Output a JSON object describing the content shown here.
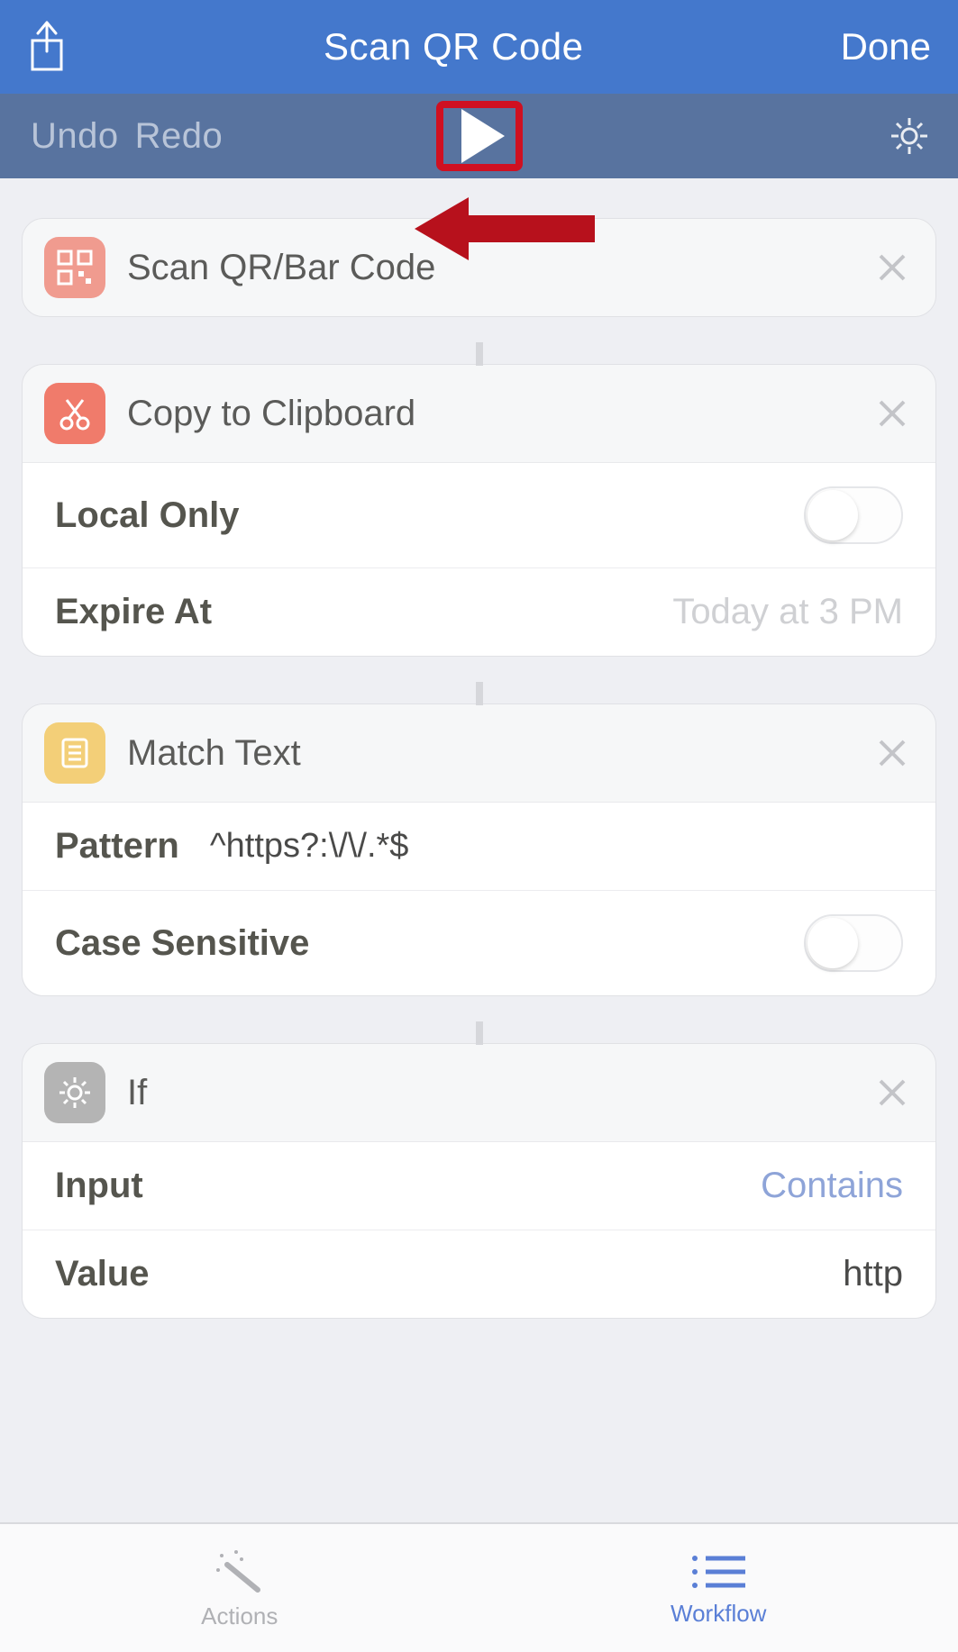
{
  "navbar": {
    "title": "Scan QR Code",
    "done": "Done"
  },
  "toolbar": {
    "undo": "Undo",
    "redo": "Redo"
  },
  "cards": {
    "scan": {
      "title": "Scan QR/Bar Code"
    },
    "copy": {
      "title": "Copy to Clipboard",
      "local_only_label": "Local Only",
      "expire_label": "Expire At",
      "expire_value": "Today at 3 PM"
    },
    "match": {
      "title": "Match Text",
      "pattern_label": "Pattern",
      "pattern_value": "^https?:\\/\\/.*$",
      "case_label": "Case Sensitive"
    },
    "if": {
      "title": "If",
      "input_label": "Input",
      "input_value": "Contains",
      "value_label": "Value",
      "value_value": "http"
    }
  },
  "tabs": {
    "actions": "Actions",
    "workflow": "Workflow"
  }
}
